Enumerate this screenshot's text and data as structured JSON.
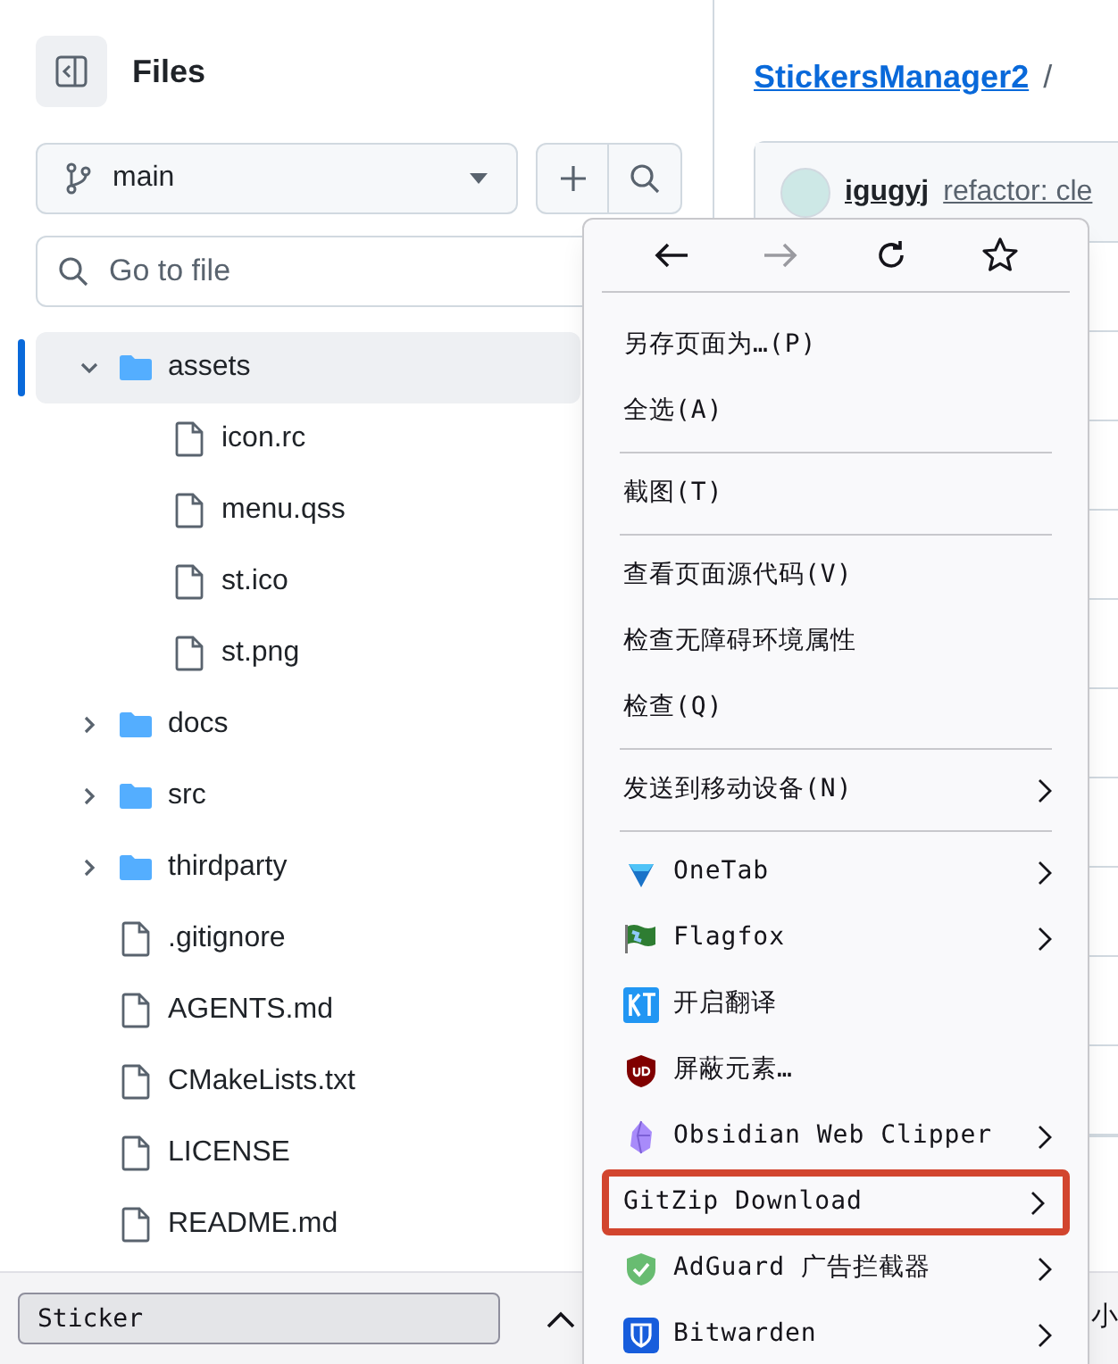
{
  "sidebar": {
    "title": "Files",
    "branch": "main",
    "search": {
      "placeholder": "Go to file"
    },
    "tree": [
      {
        "kind": "folder",
        "name": "assets",
        "expanded": true,
        "selected": true,
        "children": [
          {
            "kind": "file",
            "name": "icon.rc",
            "selected": false
          },
          {
            "kind": "file",
            "name": "menu.qss",
            "selected": false
          },
          {
            "kind": "file",
            "name": "st.ico",
            "selected": false
          },
          {
            "kind": "file",
            "name": "st.png",
            "selected": false
          }
        ]
      },
      {
        "kind": "folder",
        "name": "docs",
        "expanded": false,
        "selected": false
      },
      {
        "kind": "folder",
        "name": "src",
        "expanded": false,
        "selected": false
      },
      {
        "kind": "folder",
        "name": "thirdparty",
        "expanded": false,
        "selected": false
      },
      {
        "kind": "file",
        "name": ".gitignore",
        "selected": false
      },
      {
        "kind": "file",
        "name": "AGENTS.md",
        "selected": false
      },
      {
        "kind": "file",
        "name": "CMakeLists.txt",
        "selected": false
      },
      {
        "kind": "file",
        "name": "LICENSE",
        "selected": false
      },
      {
        "kind": "file",
        "name": "README.md",
        "selected": false
      }
    ]
  },
  "main": {
    "repo_link": "StickersManager2",
    "separator": "/",
    "commit": {
      "author": "igugyj",
      "message": "refactor: cle"
    }
  },
  "context_menu": {
    "nav": [
      {
        "kind": "back",
        "disabled": false
      },
      {
        "kind": "forward",
        "disabled": true
      },
      {
        "kind": "reload",
        "disabled": false
      },
      {
        "kind": "bookmark",
        "disabled": false
      }
    ],
    "items": [
      {
        "kind": "item",
        "label": "另存页面为…(P)",
        "submenu": false,
        "highlighted": false
      },
      {
        "kind": "item",
        "label": "全选(A)",
        "submenu": false,
        "highlighted": false
      },
      {
        "kind": "separator"
      },
      {
        "kind": "item",
        "label": "截图(T)",
        "submenu": false,
        "highlighted": false
      },
      {
        "kind": "separator"
      },
      {
        "kind": "item",
        "label": "查看页面源代码(V)",
        "submenu": false,
        "highlighted": false
      },
      {
        "kind": "item",
        "label": "检查无障碍环境属性",
        "submenu": false,
        "highlighted": false
      },
      {
        "kind": "item",
        "label": "检查(Q)",
        "submenu": false,
        "highlighted": false
      },
      {
        "kind": "separator"
      },
      {
        "kind": "item",
        "label": "发送到移动设备(N)",
        "submenu": true,
        "highlighted": false
      },
      {
        "kind": "separator"
      },
      {
        "kind": "extension",
        "label": "OneTab",
        "submenu": true,
        "highlighted": false
      },
      {
        "kind": "extension",
        "label": "Flagfox",
        "submenu": true,
        "highlighted": false
      },
      {
        "kind": "extension",
        "label": "开启翻译",
        "submenu": false,
        "highlighted": false
      },
      {
        "kind": "extension",
        "label": "屏蔽元素…",
        "submenu": false,
        "highlighted": false
      },
      {
        "kind": "extension",
        "label": "Obsidian Web Clipper",
        "submenu": true,
        "highlighted": false
      },
      {
        "kind": "item",
        "label": "GitZip Download",
        "submenu": true,
        "highlighted": true
      },
      {
        "kind": "extension",
        "label": "AdGuard 广告拦截器",
        "submenu": true,
        "highlighted": false
      },
      {
        "kind": "extension",
        "label": "Bitwarden",
        "submenu": true,
        "highlighted": false
      }
    ]
  },
  "find_bar": {
    "value": "Sticker",
    "trailing_text": "小"
  }
}
